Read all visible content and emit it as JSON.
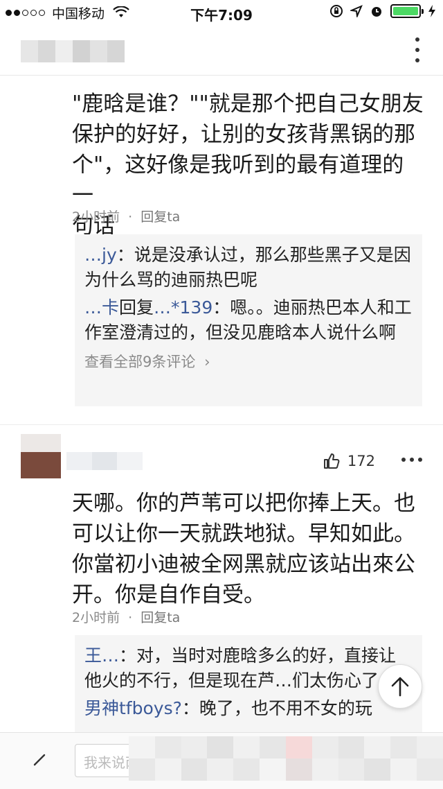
{
  "status_bar": {
    "carrier": "中国移动",
    "time": "下午7:09"
  },
  "comments": [
    {
      "text_lines": [
        "\"鹿晗是谁？\"\"就是那个把自己女朋友",
        "保护的好好，让别的女孩背黑锅的那",
        "个\"，这好像是我听到的最有道理的一",
        "句话"
      ],
      "time": "2小时前",
      "sep": "·",
      "reply_label": "回复ta",
      "replies": [
        {
          "name": "…jy",
          "text": "：说是没承认过，那么那些黑子又是因为什么骂的迪丽热巴呢"
        },
        {
          "name": "…卡",
          "mid": "回复",
          "name2": "…*139",
          "text": "：嗯。。迪丽热巴本人和工作室澄清过的，但没见鹿晗本人说什么啊"
        }
      ],
      "view_all": "查看全部9条评论"
    },
    {
      "likes": "172",
      "text_lines": [
        "天哪。你的芦苇可以把你捧上天。也",
        "可以让你一天就跌地狱。早知如此。",
        "你當初小迪被全网黑就应该站出來公",
        "开。你是自作自受。"
      ],
      "time": "2小时前",
      "sep": "·",
      "reply_label": "回复ta",
      "replies": [
        {
          "name": "王…",
          "text": "：对，当时对鹿晗多么的好，直接让他火的不行，但是现在芦…们太伤心了"
        },
        {
          "name": "男神tfboys?",
          "text": "：晚了，也不用不女的玩"
        }
      ]
    }
  ],
  "input": {
    "placeholder": "我来说两句"
  },
  "colors": {
    "accent_link": "#3b5998",
    "battery": "#4cd964"
  }
}
